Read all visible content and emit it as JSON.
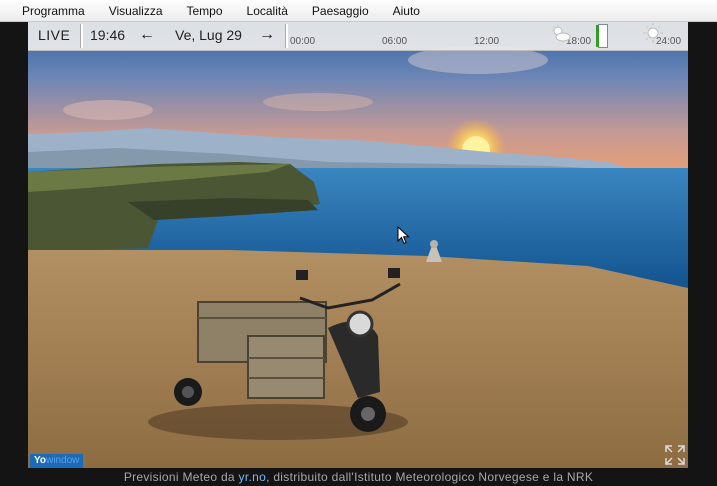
{
  "menu": {
    "items": [
      "Programma",
      "Visualizza",
      "Tempo",
      "Località",
      "Paesaggio",
      "Aiuto"
    ]
  },
  "toolbar": {
    "live_label": "LIVE",
    "time": "19:46",
    "date": "Ve, Lug 29",
    "prev_icon": "arrow-left-icon",
    "next_icon": "arrow-right-icon",
    "timeline_ticks": [
      "00:00",
      "06:00",
      "12:00",
      "18:00",
      "24:00"
    ],
    "weather_icons": [
      "partly-cloudy-icon",
      "sun-icon"
    ]
  },
  "badge": {
    "prefix": "Yo",
    "rest": "window"
  },
  "footer": {
    "text_before": "Previsioni Meteo da ",
    "link": "yr.no",
    "text_after": ", distribuito dall'Istituto Meteorologico Norvegese e la NRK"
  },
  "colors": {
    "sky_top": "#2d5fa0",
    "sky_horizon": "#e8a57a",
    "sea": "#1c6cad",
    "ground": "#a8865a",
    "timeline_marker": "#2e9d2a"
  }
}
